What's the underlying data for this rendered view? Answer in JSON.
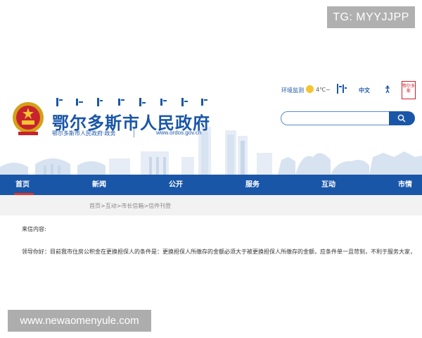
{
  "watermarks": {
    "top": "TG: MYYJJPP",
    "bottom": "www.newaomenyule.com"
  },
  "header": {
    "site_title": "鄂尔多斯市人民政府",
    "subtitle": "鄂尔多斯市人民政府·政务",
    "url": "www.ordos.gov.cn",
    "utilities": {
      "env_monitor": "环境监测",
      "temperature": "4℃~",
      "chinese": "中文"
    },
    "seal_text": "鄂尔多斯",
    "search": {
      "placeholder": ""
    }
  },
  "nav": {
    "items": [
      {
        "label": "首页",
        "active": true
      },
      {
        "label": "新闻"
      },
      {
        "label": "公开"
      },
      {
        "label": "服务"
      },
      {
        "label": "互动"
      },
      {
        "label": "市情"
      }
    ]
  },
  "breadcrumb": "首页>互动>市长信箱>信件刊登",
  "letter": {
    "heading": "来信内容:",
    "body": "领导你好：目前我市住房公积金在更换担保人的条件是：更换担保人所缴存的金额必须大于被更换担保人所缴存的金额，应条件单一且苛刻，不利于服务大家，"
  },
  "colors": {
    "primary_blue": "#1a56a8",
    "active_underline": "#e2322b",
    "breadcrumb_bg": "#f2f2f2"
  },
  "icons": [
    "national-emblem-icon",
    "sun-icon",
    "accessibility-icon",
    "search-icon"
  ]
}
